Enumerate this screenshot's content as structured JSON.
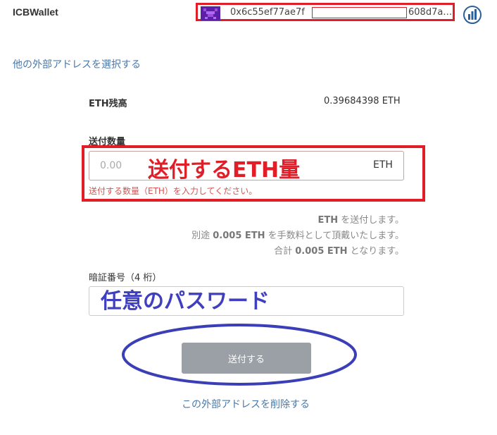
{
  "header": {
    "brand": "ICBWallet",
    "address_start": "0x6c55ef77ae7f",
    "address_end": "608d7a…",
    "avatar_icon": "pixel-avatar-icon",
    "chart_icon": "bar-chart-icon"
  },
  "links": {
    "select_other": "他の外部アドレスを選択する",
    "delete": "この外部アドレスを削除する"
  },
  "balance": {
    "label": "ETH残高",
    "value": "0.39684398 ETH"
  },
  "amount": {
    "label": "送付数量",
    "placeholder": "0.00",
    "unit": "ETH",
    "error": "送付する数量（ETH）を入力してください。",
    "annotation": "送付するETH量"
  },
  "summary": {
    "line1_value": "ETH",
    "line1_suffix": " を送付します。",
    "line2_prefix": "別途 ",
    "line2_value": "0.005 ETH",
    "line2_suffix": " を手数料として頂戴いたします。",
    "line3_prefix": "合計 ",
    "line3_value": "0.005 ETH",
    "line3_suffix": " となります。"
  },
  "pin": {
    "label": "暗証番号（4 桁）",
    "annotation": "任意のパスワード"
  },
  "button": {
    "send": "送付する"
  },
  "colors": {
    "highlight_red": "#e11d27",
    "annotation_blue": "#3f3fbf",
    "link_blue": "#4a78a8",
    "button_gray": "#9aa0a6"
  }
}
